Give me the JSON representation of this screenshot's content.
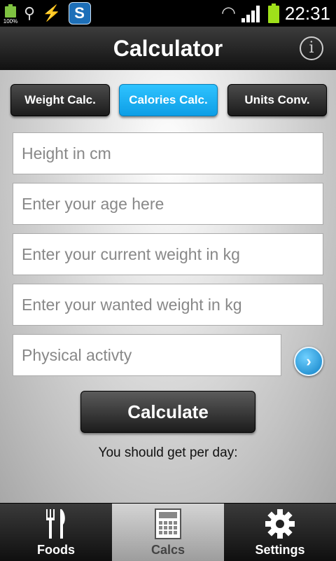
{
  "status_bar": {
    "battery_percent_label": "100%",
    "time": "22:31",
    "app_badge": "S"
  },
  "header": {
    "title": "Calculator",
    "info_label": "i"
  },
  "tabs": [
    {
      "label": "Weight Calc.",
      "active": false
    },
    {
      "label": "Calories Calc.",
      "active": true
    },
    {
      "label": "Units Conv.",
      "active": false
    }
  ],
  "form": {
    "height_placeholder": "Height in cm",
    "age_placeholder": "Enter your age here",
    "current_weight_placeholder": "Enter your current weight in kg",
    "wanted_weight_placeholder": "Enter your wanted weight in kg",
    "activity_placeholder": "Physical activty",
    "calculate_label": "Calculate",
    "result_label": "You should get per day:"
  },
  "bottom_nav": [
    {
      "label": "Foods",
      "icon": "fork-knife-icon",
      "active": false
    },
    {
      "label": "Calcs",
      "icon": "calculator-icon",
      "active": true
    },
    {
      "label": "Settings",
      "icon": "gear-icon",
      "active": false
    }
  ],
  "colors": {
    "accent": "#12aef5",
    "active_nav": "#b8b8b8"
  }
}
